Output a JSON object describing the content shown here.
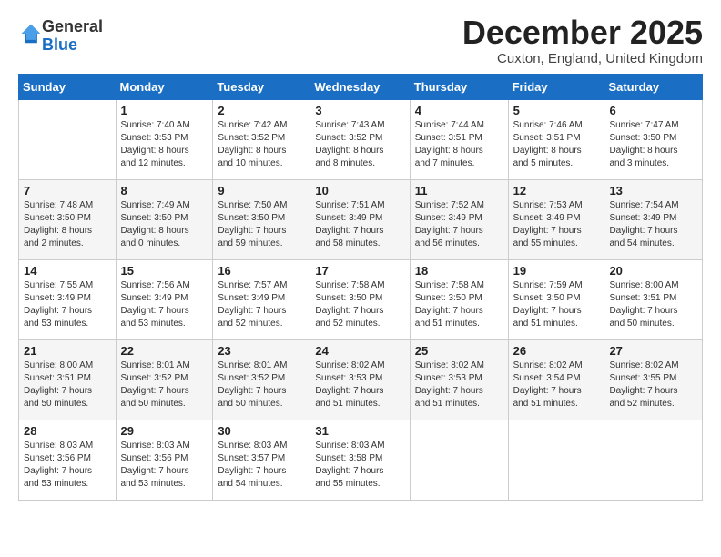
{
  "logo": {
    "general": "General",
    "blue": "Blue"
  },
  "title": "December 2025",
  "location": "Cuxton, England, United Kingdom",
  "days_of_week": [
    "Sunday",
    "Monday",
    "Tuesday",
    "Wednesday",
    "Thursday",
    "Friday",
    "Saturday"
  ],
  "weeks": [
    [
      {
        "day": "",
        "info": ""
      },
      {
        "day": "1",
        "info": "Sunrise: 7:40 AM\nSunset: 3:53 PM\nDaylight: 8 hours\nand 12 minutes."
      },
      {
        "day": "2",
        "info": "Sunrise: 7:42 AM\nSunset: 3:52 PM\nDaylight: 8 hours\nand 10 minutes."
      },
      {
        "day": "3",
        "info": "Sunrise: 7:43 AM\nSunset: 3:52 PM\nDaylight: 8 hours\nand 8 minutes."
      },
      {
        "day": "4",
        "info": "Sunrise: 7:44 AM\nSunset: 3:51 PM\nDaylight: 8 hours\nand 7 minutes."
      },
      {
        "day": "5",
        "info": "Sunrise: 7:46 AM\nSunset: 3:51 PM\nDaylight: 8 hours\nand 5 minutes."
      },
      {
        "day": "6",
        "info": "Sunrise: 7:47 AM\nSunset: 3:50 PM\nDaylight: 8 hours\nand 3 minutes."
      }
    ],
    [
      {
        "day": "7",
        "info": "Sunrise: 7:48 AM\nSunset: 3:50 PM\nDaylight: 8 hours\nand 2 minutes."
      },
      {
        "day": "8",
        "info": "Sunrise: 7:49 AM\nSunset: 3:50 PM\nDaylight: 8 hours\nand 0 minutes."
      },
      {
        "day": "9",
        "info": "Sunrise: 7:50 AM\nSunset: 3:50 PM\nDaylight: 7 hours\nand 59 minutes."
      },
      {
        "day": "10",
        "info": "Sunrise: 7:51 AM\nSunset: 3:49 PM\nDaylight: 7 hours\nand 58 minutes."
      },
      {
        "day": "11",
        "info": "Sunrise: 7:52 AM\nSunset: 3:49 PM\nDaylight: 7 hours\nand 56 minutes."
      },
      {
        "day": "12",
        "info": "Sunrise: 7:53 AM\nSunset: 3:49 PM\nDaylight: 7 hours\nand 55 minutes."
      },
      {
        "day": "13",
        "info": "Sunrise: 7:54 AM\nSunset: 3:49 PM\nDaylight: 7 hours\nand 54 minutes."
      }
    ],
    [
      {
        "day": "14",
        "info": "Sunrise: 7:55 AM\nSunset: 3:49 PM\nDaylight: 7 hours\nand 53 minutes."
      },
      {
        "day": "15",
        "info": "Sunrise: 7:56 AM\nSunset: 3:49 PM\nDaylight: 7 hours\nand 53 minutes."
      },
      {
        "day": "16",
        "info": "Sunrise: 7:57 AM\nSunset: 3:49 PM\nDaylight: 7 hours\nand 52 minutes."
      },
      {
        "day": "17",
        "info": "Sunrise: 7:58 AM\nSunset: 3:50 PM\nDaylight: 7 hours\nand 52 minutes."
      },
      {
        "day": "18",
        "info": "Sunrise: 7:58 AM\nSunset: 3:50 PM\nDaylight: 7 hours\nand 51 minutes."
      },
      {
        "day": "19",
        "info": "Sunrise: 7:59 AM\nSunset: 3:50 PM\nDaylight: 7 hours\nand 51 minutes."
      },
      {
        "day": "20",
        "info": "Sunrise: 8:00 AM\nSunset: 3:51 PM\nDaylight: 7 hours\nand 50 minutes."
      }
    ],
    [
      {
        "day": "21",
        "info": "Sunrise: 8:00 AM\nSunset: 3:51 PM\nDaylight: 7 hours\nand 50 minutes."
      },
      {
        "day": "22",
        "info": "Sunrise: 8:01 AM\nSunset: 3:52 PM\nDaylight: 7 hours\nand 50 minutes."
      },
      {
        "day": "23",
        "info": "Sunrise: 8:01 AM\nSunset: 3:52 PM\nDaylight: 7 hours\nand 50 minutes."
      },
      {
        "day": "24",
        "info": "Sunrise: 8:02 AM\nSunset: 3:53 PM\nDaylight: 7 hours\nand 51 minutes."
      },
      {
        "day": "25",
        "info": "Sunrise: 8:02 AM\nSunset: 3:53 PM\nDaylight: 7 hours\nand 51 minutes."
      },
      {
        "day": "26",
        "info": "Sunrise: 8:02 AM\nSunset: 3:54 PM\nDaylight: 7 hours\nand 51 minutes."
      },
      {
        "day": "27",
        "info": "Sunrise: 8:02 AM\nSunset: 3:55 PM\nDaylight: 7 hours\nand 52 minutes."
      }
    ],
    [
      {
        "day": "28",
        "info": "Sunrise: 8:03 AM\nSunset: 3:56 PM\nDaylight: 7 hours\nand 53 minutes."
      },
      {
        "day": "29",
        "info": "Sunrise: 8:03 AM\nSunset: 3:56 PM\nDaylight: 7 hours\nand 53 minutes."
      },
      {
        "day": "30",
        "info": "Sunrise: 8:03 AM\nSunset: 3:57 PM\nDaylight: 7 hours\nand 54 minutes."
      },
      {
        "day": "31",
        "info": "Sunrise: 8:03 AM\nSunset: 3:58 PM\nDaylight: 7 hours\nand 55 minutes."
      },
      {
        "day": "",
        "info": ""
      },
      {
        "day": "",
        "info": ""
      },
      {
        "day": "",
        "info": ""
      }
    ]
  ]
}
